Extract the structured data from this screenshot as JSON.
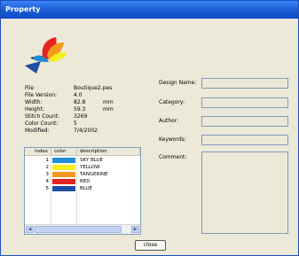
{
  "window": {
    "title": "Property"
  },
  "file_info": [
    {
      "label": "File",
      "value": "Boutique2.pes",
      "unit": ""
    },
    {
      "label": "File Version:",
      "value": "4.0",
      "unit": ""
    },
    {
      "label": "Width:",
      "value": "82.8",
      "unit": "mm"
    },
    {
      "label": "Height:",
      "value": "59.3",
      "unit": "mm"
    },
    {
      "label": "Stitch Count:",
      "value": "3269",
      "unit": ""
    },
    {
      "label": "Color Count:",
      "value": "5",
      "unit": ""
    },
    {
      "label": "Modified:",
      "value": "7/4/2002",
      "unit": ""
    }
  ],
  "color_list": {
    "headers": {
      "index": "index",
      "color": "color",
      "description": "description"
    },
    "rows": [
      {
        "index": "1",
        "color": "#1f8fd4",
        "description": "SKY BLUE"
      },
      {
        "index": "2",
        "color": "#f6ee1c",
        "description": "YELLOW"
      },
      {
        "index": "3",
        "color": "#f29a1f",
        "description": "TANGERINE"
      },
      {
        "index": "4",
        "color": "#e52420",
        "description": "RED"
      },
      {
        "index": "5",
        "color": "#1c4fa3",
        "description": "BLUE"
      }
    ]
  },
  "fields": {
    "design_name": "Design Name:",
    "category": "Category:",
    "author": "Author:",
    "keywords": "Keywords:",
    "comment": "Comment:"
  },
  "buttons": {
    "close": "close"
  },
  "scroll_arrows": {
    "left": "◀",
    "right": "▶"
  }
}
